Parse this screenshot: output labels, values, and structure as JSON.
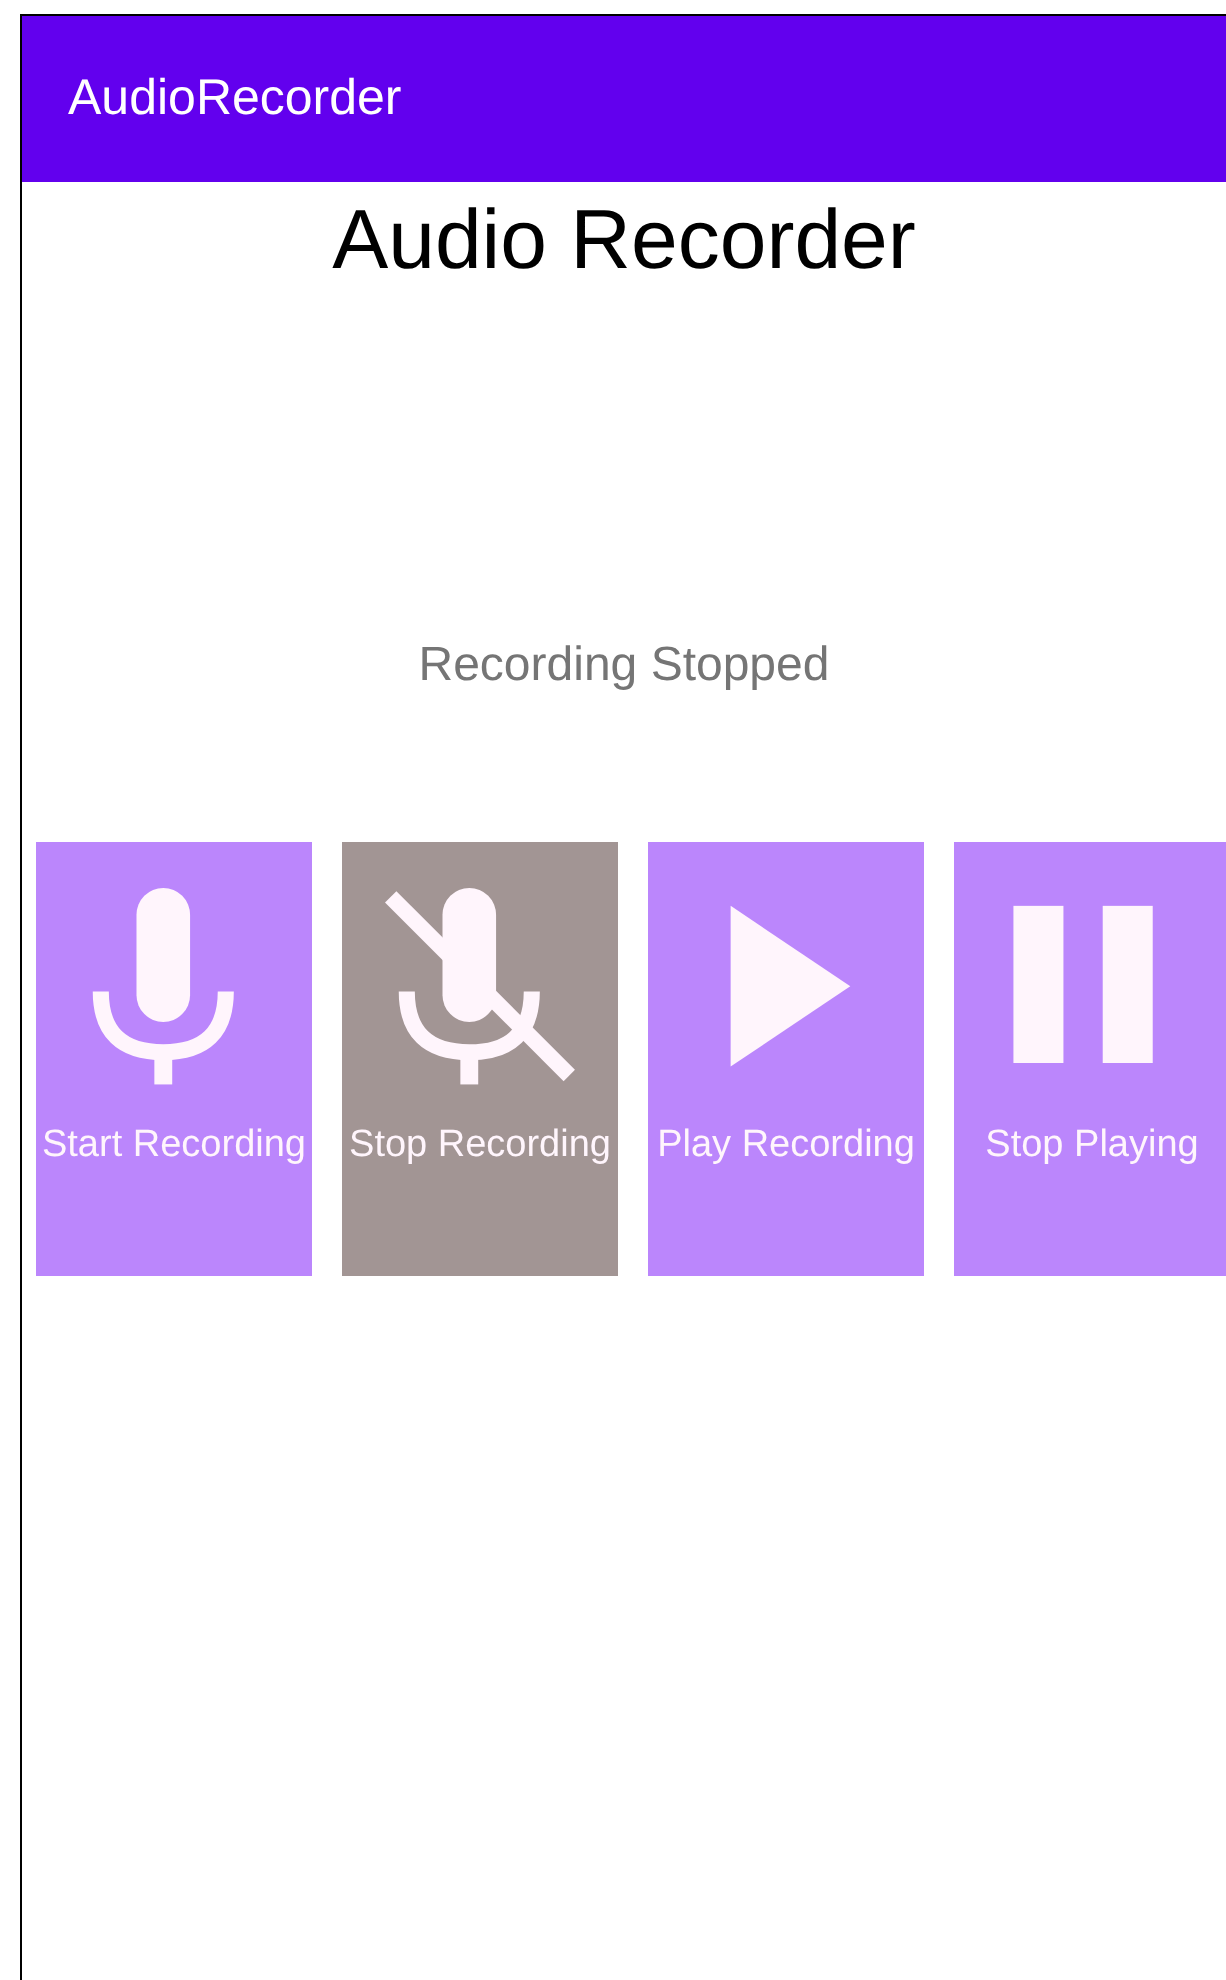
{
  "app_bar": {
    "title": "AudioRecorder"
  },
  "heading": "Audio Recorder",
  "status": "Recording Stopped",
  "buttons": [
    {
      "label": "Start Recording",
      "kind": "mic",
      "disabled": false
    },
    {
      "label": "Stop Recording",
      "kind": "mic-off",
      "disabled": true
    },
    {
      "label": "Play Recording",
      "kind": "play",
      "disabled": false
    },
    {
      "label": "Stop Playing",
      "kind": "pause",
      "disabled": false
    }
  ]
}
